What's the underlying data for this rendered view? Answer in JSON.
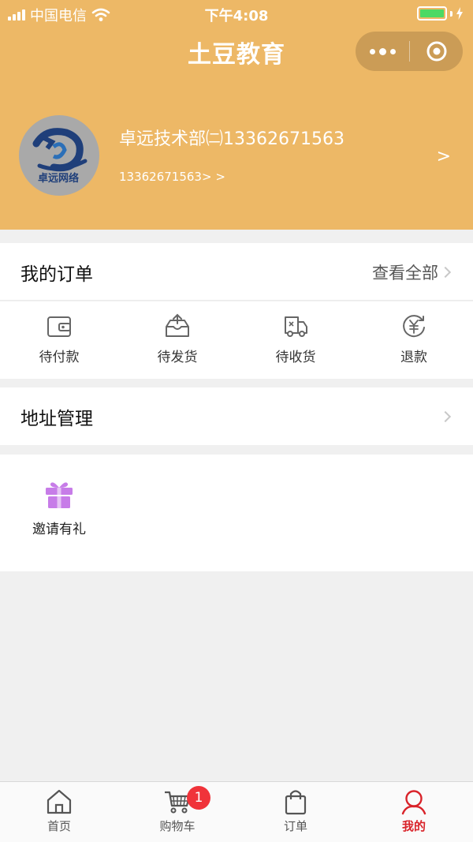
{
  "status_bar": {
    "carrier": "中国电信",
    "time": "下午4:08"
  },
  "nav": {
    "title": "土豆教育"
  },
  "profile": {
    "name": "卓远技术部㈡13362671563",
    "phone": "13362671563> >",
    "arrow": ">",
    "avatar_caption": "卓远网络"
  },
  "orders": {
    "title": "我的订单",
    "view_all": "查看全部",
    "items": [
      {
        "label": "待付款",
        "icon": "wallet-icon"
      },
      {
        "label": "待发货",
        "icon": "box-icon"
      },
      {
        "label": "待收货",
        "icon": "truck-icon"
      },
      {
        "label": "退款",
        "icon": "refund-icon"
      }
    ]
  },
  "address": {
    "title": "地址管理"
  },
  "extras": {
    "invite_label": "邀请有礼",
    "icon": "gift-icon",
    "icon_color": "#c77ce8"
  },
  "tabbar": {
    "items": [
      {
        "label": "首页",
        "icon": "home-icon"
      },
      {
        "label": "购物车",
        "icon": "cart-icon",
        "badge": "1"
      },
      {
        "label": "订单",
        "icon": "bag-icon"
      },
      {
        "label": "我的",
        "icon": "profile-icon"
      }
    ],
    "active": "我的",
    "active_color": "#d9232a"
  },
  "colors": {
    "header_bg": "#edb866",
    "page_bg": "#f0f0f0",
    "badge": "#f0333a"
  }
}
